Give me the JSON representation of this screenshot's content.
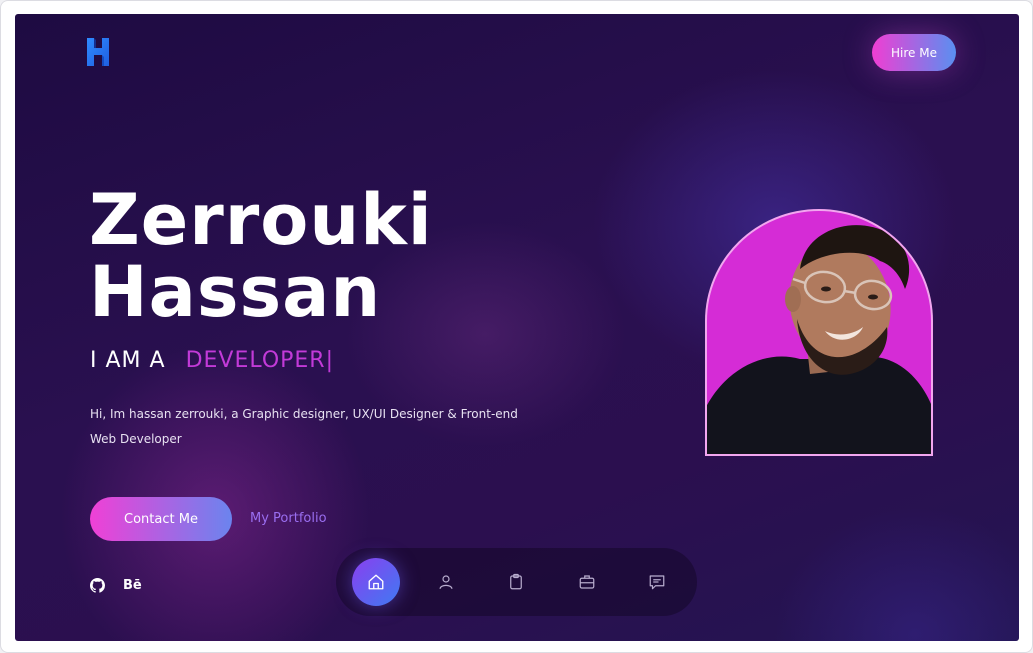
{
  "header": {
    "logo_letter": "H",
    "hire_button": "Hire Me"
  },
  "hero": {
    "name_line1": "Zerrouki",
    "name_line2": "Hassan",
    "role_prefix": "I AM A",
    "role_typed": "DEVELOPER",
    "role_cursor": "|",
    "bio": "Hi, Im hassan zerrouki, a Graphic designer, UX/UI Designer & Front-end Web Developer",
    "contact_button": "Contact Me",
    "portfolio_link": "My Portfolio"
  },
  "social": {
    "github_icon": "github-icon",
    "behance_label": "Bē"
  },
  "bottom_nav": {
    "items": [
      {
        "icon": "home-icon",
        "active": true
      },
      {
        "icon": "user-icon",
        "active": false
      },
      {
        "icon": "clipboard-icon",
        "active": false
      },
      {
        "icon": "briefcase-icon",
        "active": false
      },
      {
        "icon": "message-icon",
        "active": false
      }
    ]
  },
  "colors": {
    "accent_pink": "#f03ed3",
    "accent_blue": "#5a8ff0",
    "role_highlight": "#c23ad8",
    "photo_background": "#d52cd6",
    "background_dark": "#1e0b42"
  }
}
